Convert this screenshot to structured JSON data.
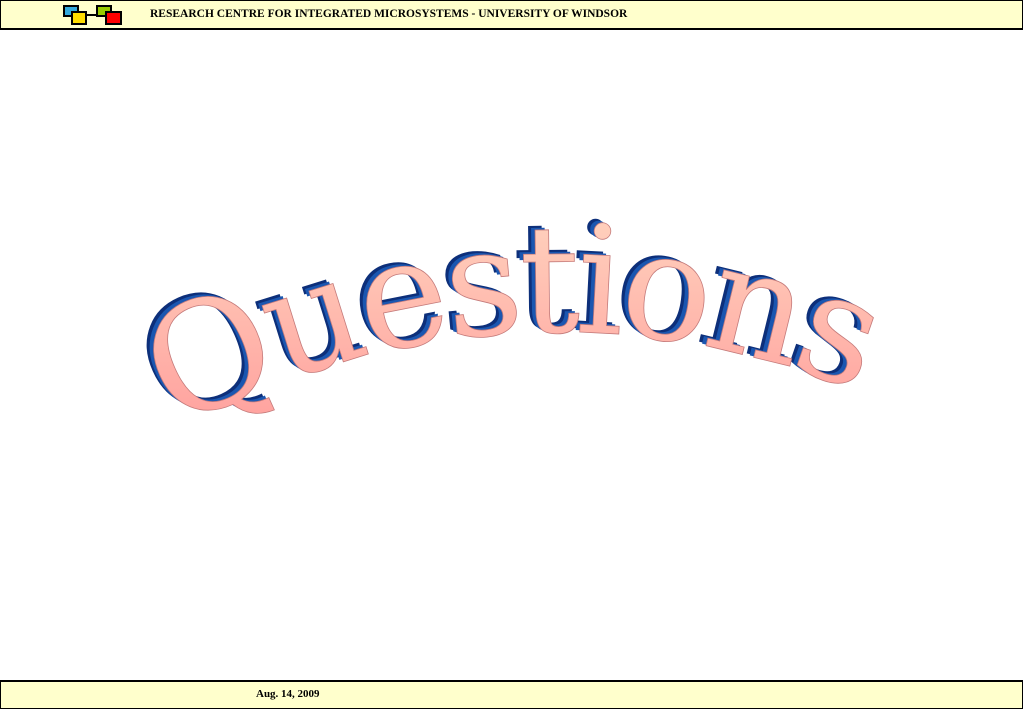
{
  "header": {
    "title": "RESEARCH CENTRE FOR INTEGRATED MICROSYSTEMS - UNIVERSITY OF WINDSOR",
    "logo_colors": [
      "#33aadd",
      "#ffdd00",
      "#99cc00",
      "#ff0000"
    ]
  },
  "slide": {
    "heading": "Questions?",
    "gradient_top": "#ffffcc",
    "gradient_bottom": "#ff9999",
    "shadow_color": "#1a3f8f"
  },
  "footer": {
    "date": "Aug. 14, 2009"
  },
  "colors": {
    "bar_background": "#ffffcc",
    "border": "#000000"
  }
}
